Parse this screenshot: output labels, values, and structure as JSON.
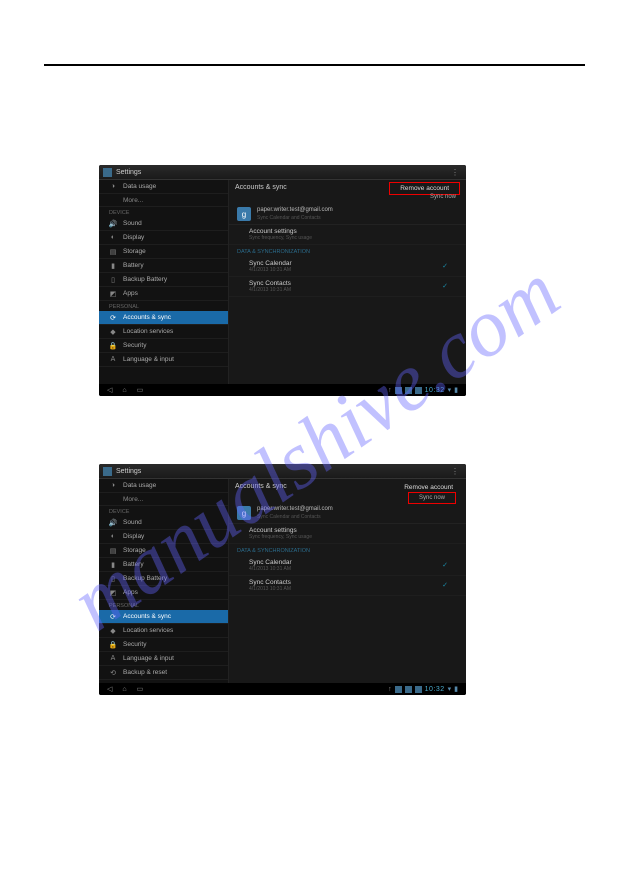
{
  "watermark": "manualshive.com",
  "screens": [
    {
      "title": "Settings",
      "action_primary": "Remove account",
      "action_primary_highlighted": true,
      "action_secondary": "Sync now",
      "action_secondary_highlighted": false,
      "crumb": "Accounts & sync",
      "crumb_sub": "",
      "account_email": "paper.writer.test@gmail.com",
      "account_sub": "Sync Calendar and Contacts",
      "section_header_device": "DEVICE",
      "section_header_personal": "PERSONAL",
      "section_header_sync": "DATA & SYNCHRONIZATION",
      "sidebar": [
        {
          "label": "Data usage",
          "icon": "◑"
        },
        {
          "label": "More...",
          "more": true
        },
        {
          "header": true,
          "label": "DEVICE"
        },
        {
          "label": "Sound",
          "icon": "🔊"
        },
        {
          "label": "Display",
          "icon": "◐"
        },
        {
          "label": "Storage",
          "icon": "▤"
        },
        {
          "label": "Battery",
          "icon": "▮"
        },
        {
          "label": "Backup Battery",
          "icon": "▯"
        },
        {
          "label": "Apps",
          "icon": "◩"
        },
        {
          "header": true,
          "label": "PERSONAL"
        },
        {
          "label": "Accounts & sync",
          "icon": "⟳",
          "active": true
        },
        {
          "label": "Location services",
          "icon": "◆"
        },
        {
          "label": "Security",
          "icon": "🔒"
        },
        {
          "label": "Language & input",
          "icon": "A"
        }
      ],
      "settings": [
        {
          "label": "Account settings",
          "sub": "Sync frequency, Sync usage"
        },
        {
          "section": true,
          "label": "DATA & SYNCHRONIZATION"
        },
        {
          "label": "Sync Calendar",
          "sub": "4/1/2013 10:31 AM",
          "checked": true
        },
        {
          "label": "Sync Contacts",
          "sub": "4/1/2013 10:31 AM",
          "checked": true
        }
      ],
      "clock": "10:32"
    },
    {
      "title": "Settings",
      "action_primary": "Remove account",
      "action_primary_highlighted": false,
      "action_secondary": "Sync now",
      "action_secondary_highlighted": true,
      "crumb": "Accounts & sync",
      "crumb_sub": "",
      "account_email": "paper.writer.test@gmail.com",
      "account_sub": "Sync Calendar and Contacts",
      "sidebar": [
        {
          "label": "Data usage",
          "icon": "◑"
        },
        {
          "label": "More...",
          "more": true
        },
        {
          "header": true,
          "label": "DEVICE"
        },
        {
          "label": "Sound",
          "icon": "🔊"
        },
        {
          "label": "Display",
          "icon": "◐"
        },
        {
          "label": "Storage",
          "icon": "▤"
        },
        {
          "label": "Battery",
          "icon": "▮"
        },
        {
          "label": "Backup Battery",
          "icon": "▯"
        },
        {
          "label": "Apps",
          "icon": "◩"
        },
        {
          "header": true,
          "label": "PERSONAL"
        },
        {
          "label": "Accounts & sync",
          "icon": "⟳",
          "active": true
        },
        {
          "label": "Location services",
          "icon": "◆"
        },
        {
          "label": "Security",
          "icon": "🔒"
        },
        {
          "label": "Language & input",
          "icon": "A"
        },
        {
          "label": "Backup & reset",
          "icon": "⟲"
        }
      ],
      "settings": [
        {
          "label": "Account settings",
          "sub": "Sync frequency, Sync usage"
        },
        {
          "section": true,
          "label": "DATA & SYNCHRONIZATION"
        },
        {
          "label": "Sync Calendar",
          "sub": "4/1/2013 10:31 AM",
          "checked": true
        },
        {
          "label": "Sync Contacts",
          "sub": "4/1/2013 10:31 AM",
          "checked": true
        }
      ],
      "clock": "10:32"
    }
  ]
}
